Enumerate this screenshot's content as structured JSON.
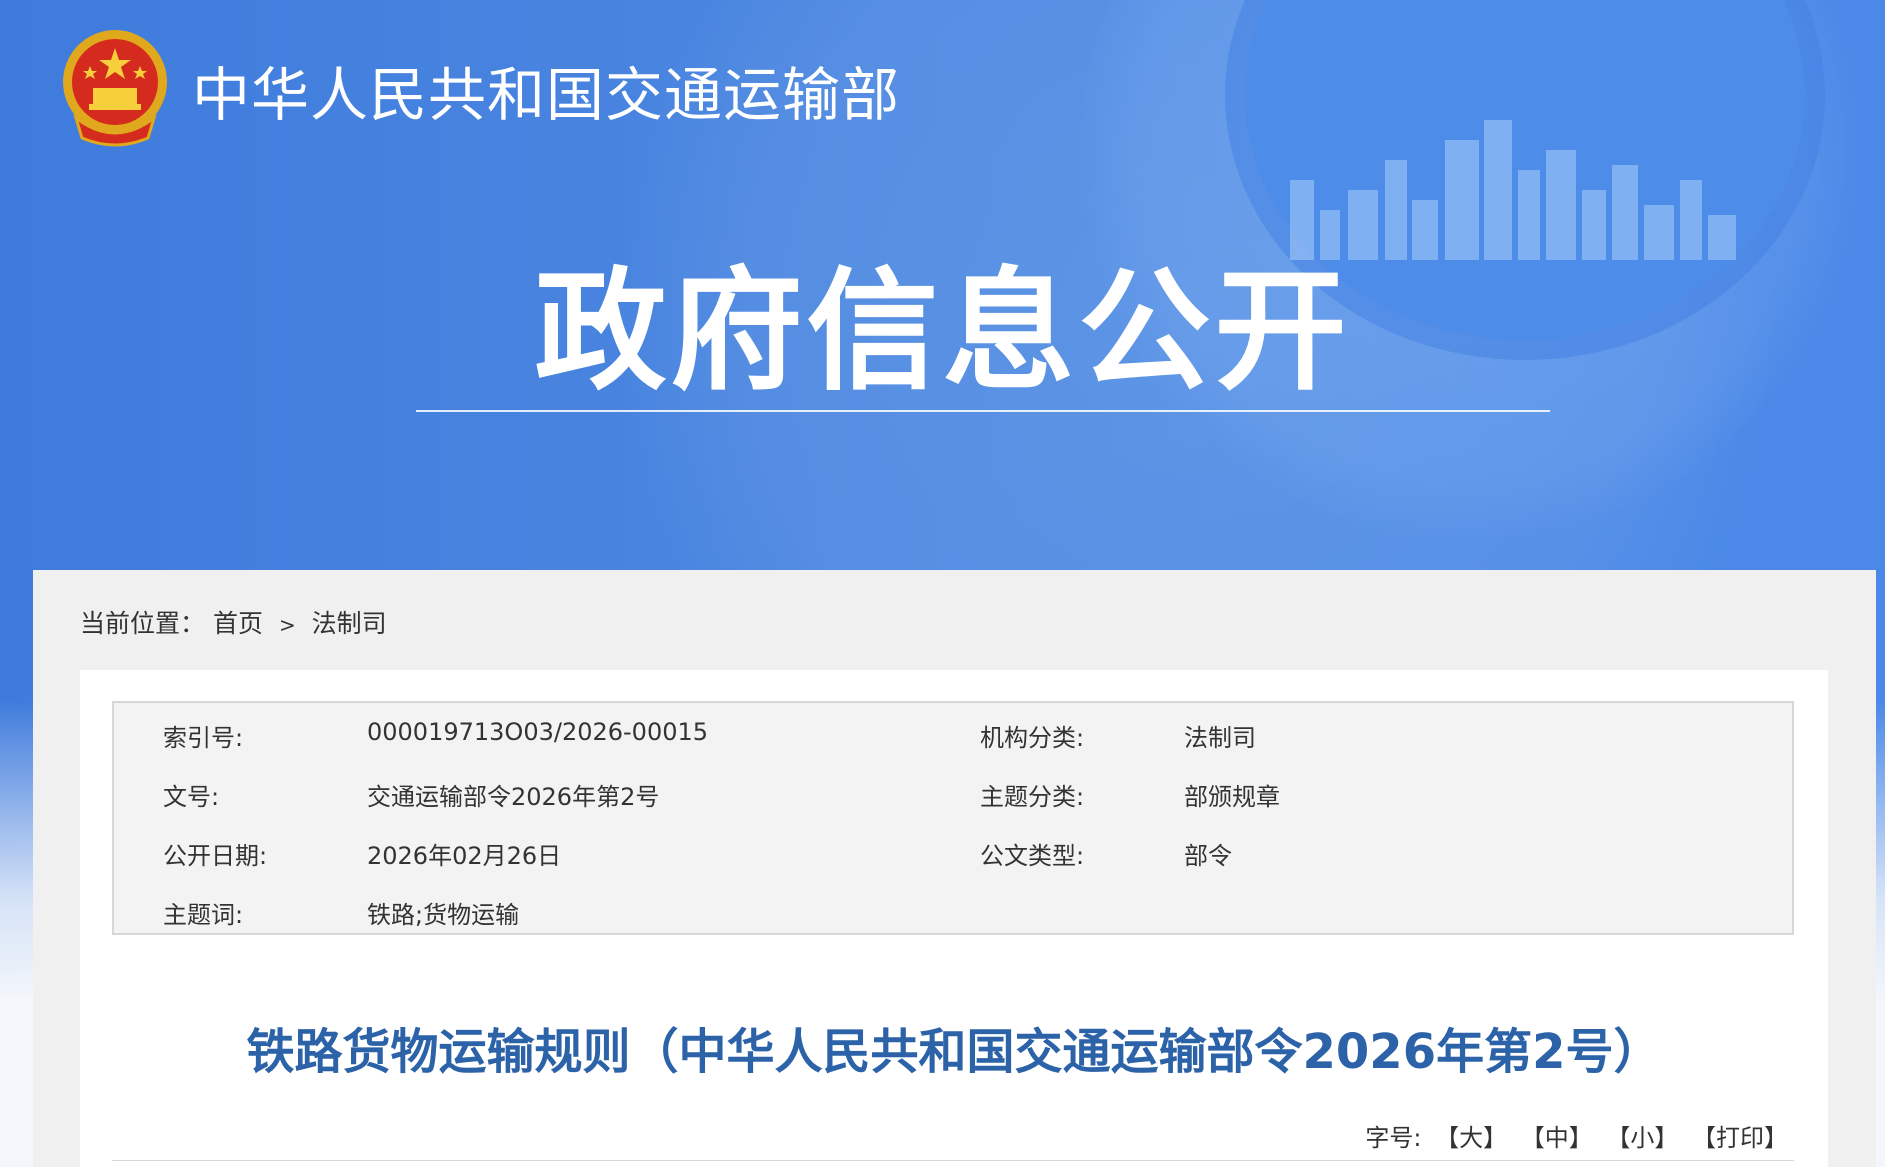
{
  "header": {
    "site_name": "中华人民共和国交通运输部",
    "hero_title": "政府信息公开"
  },
  "breadcrumb": {
    "label": "当前位置：",
    "items": [
      "首页",
      "法制司"
    ],
    "separator": ">"
  },
  "meta": {
    "index_no_label": "索引号:",
    "index_no_value": "000019713O03/2026-00015",
    "org_label": "机构分类:",
    "org_value": "法制司",
    "doc_no_label": "文号:",
    "doc_no_value": "交通运输部令2026年第2号",
    "topic_label": "主题分类:",
    "topic_value": "部颁规章",
    "date_label": "公开日期:",
    "date_value": "2026年02月26日",
    "type_label": "公文类型:",
    "type_value": "部令",
    "keywords_label": "主题词:",
    "keywords_value": "铁路;货物运输"
  },
  "document": {
    "title": "铁路货物运输规则（中华人民共和国交通运输部令2026年第2号）"
  },
  "font_tools": {
    "label": "字号:",
    "large": "【大】",
    "medium": "【中】",
    "small": "【小】",
    "print": "【打印】"
  },
  "colors": {
    "banner_blue": "#4a86e0",
    "title_blue": "#2c62a8",
    "panel_gray": "#f0f0f0"
  }
}
